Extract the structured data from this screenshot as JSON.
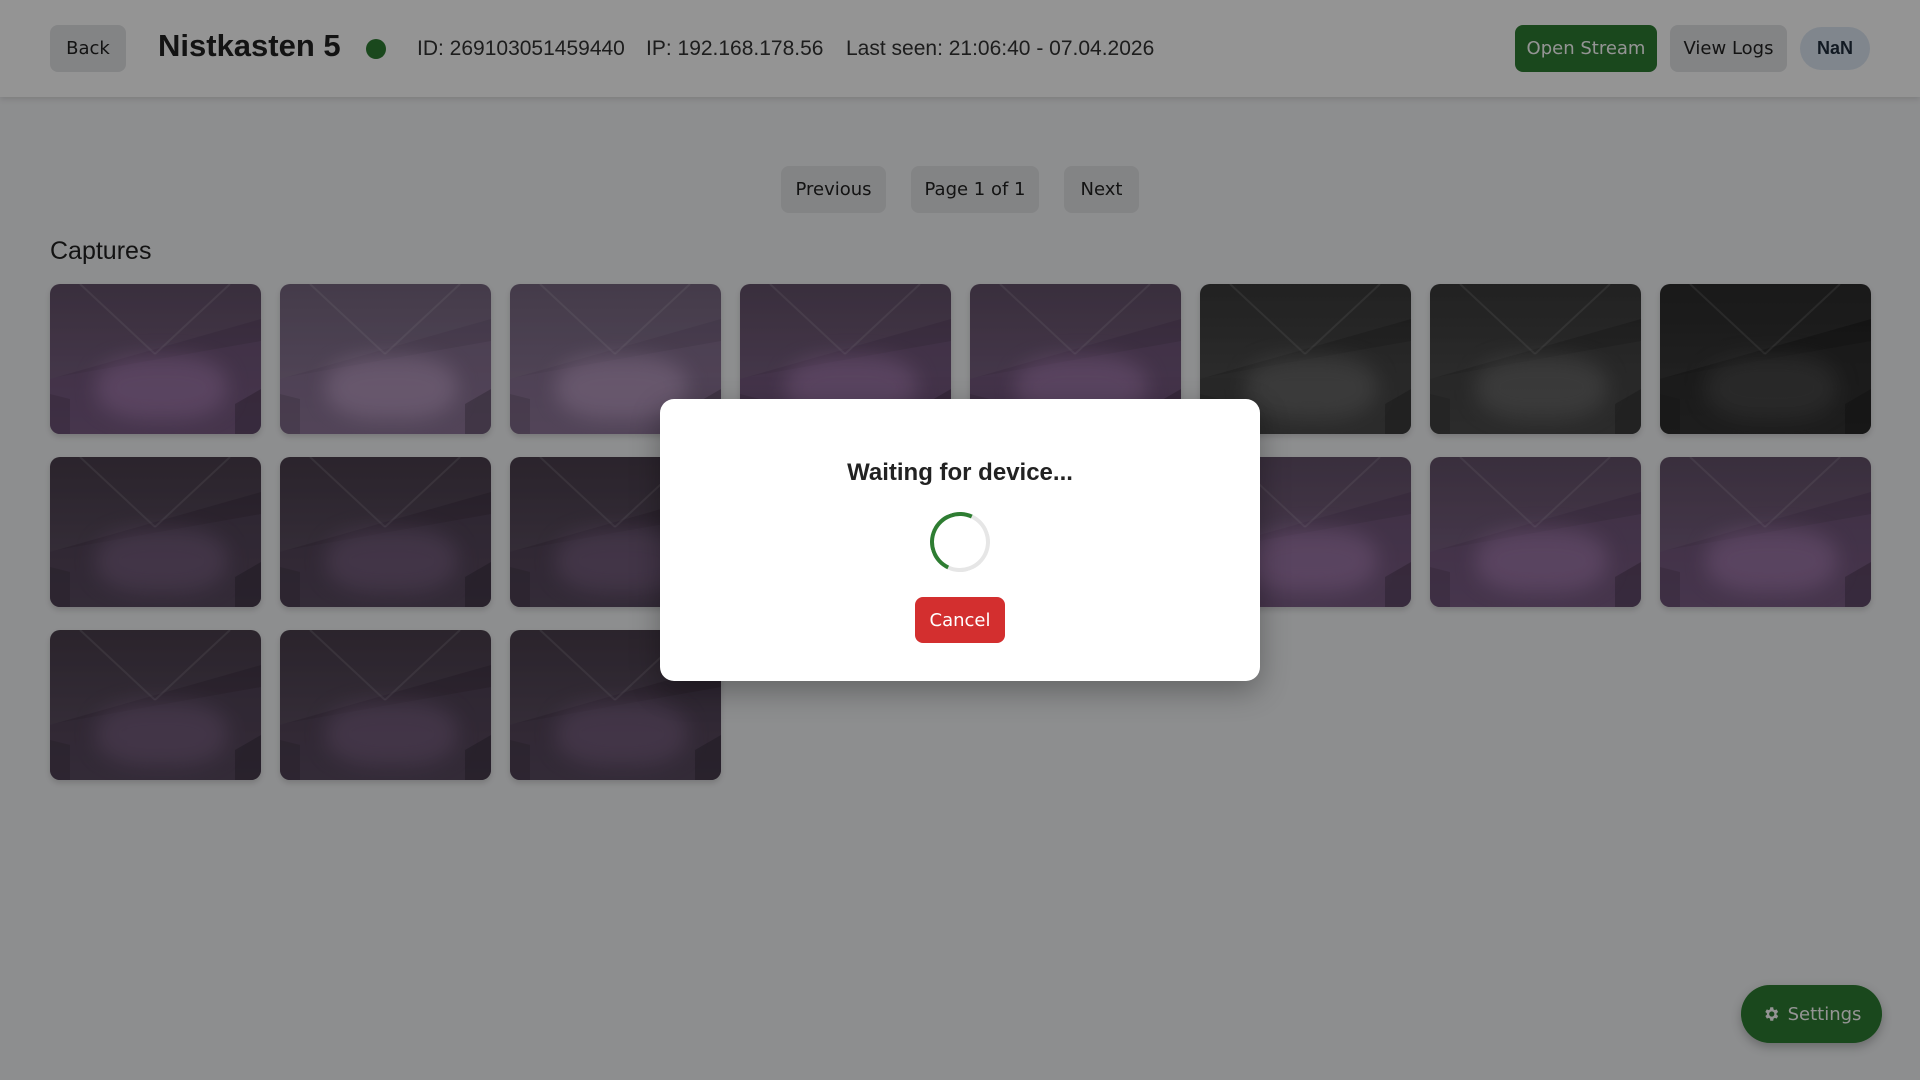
{
  "header": {
    "back_label": "Back",
    "device_name": "Nistkasten 5",
    "status_color": "#2e7d32",
    "id_text": "ID: 269103051459440",
    "ip_text": "IP: 192.168.178.56",
    "last_seen_text": "Last seen: 21:06:40 - 07.04.2026",
    "open_stream_label": "Open Stream",
    "view_logs_label": "View Logs",
    "badge_text": "NaN"
  },
  "pagination": {
    "previous_label": "Previous",
    "page_indicator": "Page 1 of 1",
    "next_label": "Next"
  },
  "captures": {
    "title": "Captures",
    "items": [
      {
        "tone": "purple"
      },
      {
        "tone": "purple-bright"
      },
      {
        "tone": "purple-bright"
      },
      {
        "tone": "purple"
      },
      {
        "tone": "purple"
      },
      {
        "tone": "gray"
      },
      {
        "tone": "gray"
      },
      {
        "tone": "gray-dark"
      },
      {
        "tone": "purple-dark"
      },
      {
        "tone": "purple-dark"
      },
      {
        "tone": "purple-dark"
      },
      {
        "tone": "purple"
      },
      {
        "tone": "purple"
      },
      {
        "tone": "purple"
      },
      {
        "tone": "purple"
      },
      {
        "tone": "purple"
      },
      {
        "tone": "purple-dark"
      },
      {
        "tone": "purple-dark"
      },
      {
        "tone": "purple-dark"
      }
    ]
  },
  "modal": {
    "title": "Waiting for device...",
    "cancel_label": "Cancel"
  },
  "settings_fab": {
    "icon": "gear-icon",
    "label": "Settings"
  },
  "colors": {
    "accent_green": "#2e7d32",
    "danger_red": "#d32f2f"
  }
}
